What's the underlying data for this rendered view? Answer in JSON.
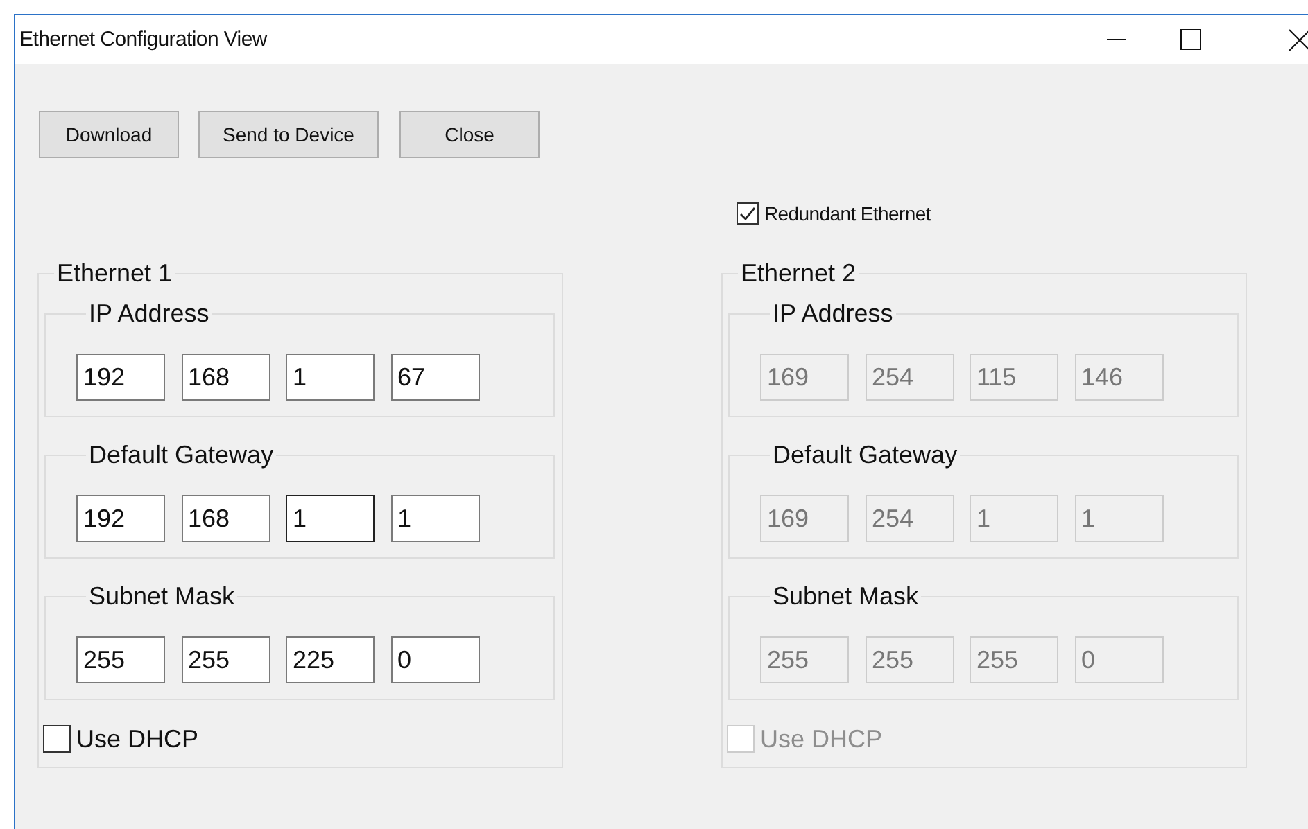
{
  "window": {
    "title": "Ethernet Configuration View"
  },
  "buttons": [
    {
      "label": "Download"
    },
    {
      "label": "Send to Device"
    },
    {
      "label": "Close"
    }
  ],
  "redundant": {
    "label": "Redundant Ethernet",
    "checked": true
  },
  "groups": [
    {
      "title": "Ethernet 1",
      "sections": [
        {
          "title": "IP Address",
          "fields": [
            {
              "value": "192",
              "disabled": false,
              "focused": false
            },
            {
              "value": "168",
              "disabled": false,
              "focused": false
            },
            {
              "value": "1",
              "disabled": false,
              "focused": false
            },
            {
              "value": "67",
              "disabled": false,
              "focused": false
            }
          ]
        },
        {
          "title": "Default Gateway",
          "fields": [
            {
              "value": "192",
              "disabled": false,
              "focused": false
            },
            {
              "value": "168",
              "disabled": false,
              "focused": false
            },
            {
              "value": "1",
              "disabled": false,
              "focused": true
            },
            {
              "value": "1",
              "disabled": false,
              "focused": false
            }
          ]
        },
        {
          "title": "Subnet Mask",
          "fields": [
            {
              "value": "255",
              "disabled": false,
              "focused": false
            },
            {
              "value": "255",
              "disabled": false,
              "focused": false
            },
            {
              "value": "225",
              "disabled": false,
              "focused": false
            },
            {
              "value": "0",
              "disabled": false,
              "focused": false
            }
          ]
        }
      ],
      "dhcp": {
        "label": "Use DHCP",
        "checked": false,
        "disabled": false
      }
    },
    {
      "title": "Ethernet 2",
      "sections": [
        {
          "title": "IP Address",
          "fields": [
            {
              "value": "169",
              "disabled": true,
              "focused": false
            },
            {
              "value": "254",
              "disabled": true,
              "focused": false
            },
            {
              "value": "115",
              "disabled": true,
              "focused": false
            },
            {
              "value": "146",
              "disabled": true,
              "focused": false
            }
          ]
        },
        {
          "title": "Default Gateway",
          "fields": [
            {
              "value": "169",
              "disabled": true,
              "focused": false
            },
            {
              "value": "254",
              "disabled": true,
              "focused": false
            },
            {
              "value": "1",
              "disabled": true,
              "focused": false
            },
            {
              "value": "1",
              "disabled": true,
              "focused": false
            }
          ]
        },
        {
          "title": "Subnet Mask",
          "fields": [
            {
              "value": "255",
              "disabled": true,
              "focused": false
            },
            {
              "value": "255",
              "disabled": true,
              "focused": false
            },
            {
              "value": "255",
              "disabled": true,
              "focused": false
            },
            {
              "value": "0",
              "disabled": true,
              "focused": false
            }
          ]
        }
      ],
      "dhcp": {
        "label": "Use DHCP",
        "checked": false,
        "disabled": true
      }
    }
  ]
}
